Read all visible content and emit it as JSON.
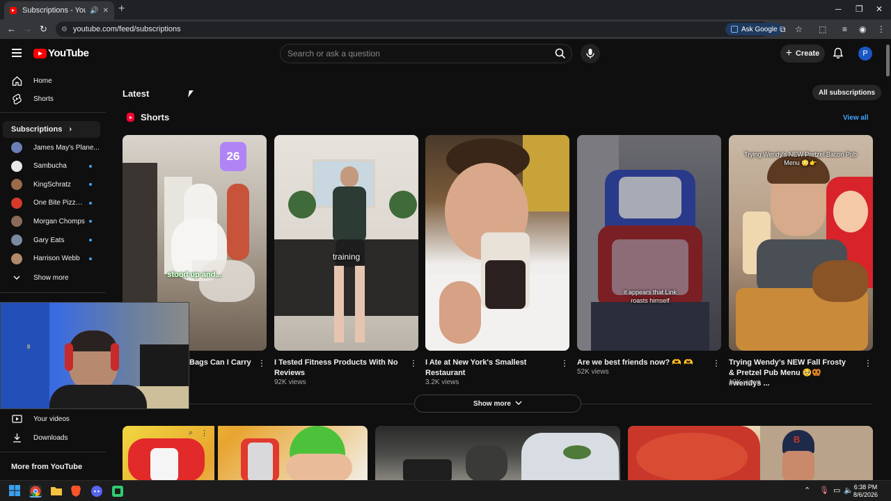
{
  "browser": {
    "tab_title": "Subscriptions - YouTube",
    "url": "youtube.com/feed/subscriptions",
    "ask_google": "Ask Google"
  },
  "header": {
    "logo_text": "YouTube",
    "search_placeholder": "Search or ask a question",
    "create_label": "Create",
    "avatar_letter": "P"
  },
  "sidebar": {
    "home": "Home",
    "shorts": "Shorts",
    "subscriptions_heading": "Subscriptions",
    "subscriptions": [
      {
        "name": "James May's Plane...",
        "color": "#6a7fb5",
        "dot": false
      },
      {
        "name": "Sambucha",
        "color": "#e8e8e8",
        "dot": true
      },
      {
        "name": "KingSchratz",
        "color": "#9b6b4a",
        "dot": true
      },
      {
        "name": "One Bite Pizza R...",
        "color": "#d63a2a",
        "dot": true
      },
      {
        "name": "Morgan Chomps",
        "color": "#8a6b5a",
        "dot": true
      },
      {
        "name": "Gary Eats",
        "color": "#7a8aa0",
        "dot": true
      },
      {
        "name": "Harrison Webb",
        "color": "#b08a6a",
        "dot": true
      }
    ],
    "show_more": "Show more",
    "your_videos": "Your videos",
    "downloads": "Downloads",
    "more_from_youtube": "More from YouTube"
  },
  "main": {
    "latest": "Latest",
    "all_subscriptions": "All subscriptions",
    "shorts_heading": "Shorts",
    "view_all": "View all",
    "show_more": "Show more",
    "shorts": [
      {
        "title": "Bags Can I Carry",
        "views": "",
        "caption": "stood up and...",
        "badge": "26"
      },
      {
        "title": "I Tested Fitness Products With No Reviews",
        "views": "92K views",
        "caption": "training"
      },
      {
        "title": "I Ate at New York's Smallest Restaurant",
        "views": "3.2K views",
        "caption": ""
      },
      {
        "title": "Are we best friends now? 🫶 🫶",
        "views": "52K views",
        "caption": "it appears that Link roasts himself"
      },
      {
        "title": "Trying Wendy's NEW Fall Frosty & Pretzel Pub Menu 🥺🥨 #wendys ...",
        "views": "12K views",
        "caption": "Trying Wendy's NEW Pretzel Bacon Pub Menu 😳👉"
      }
    ]
  },
  "taskbar": {
    "time": "6:38 PM",
    "date": "8/6/2026"
  }
}
